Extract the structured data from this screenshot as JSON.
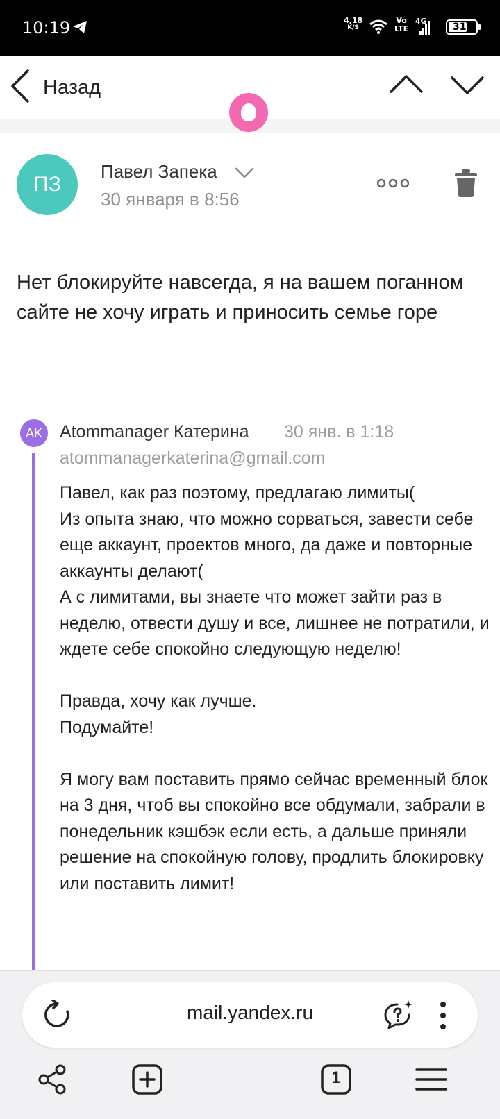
{
  "status_bar": {
    "time": "10:19",
    "speed_value": "4,18",
    "speed_unit": "K/S",
    "volte_top": "Vo",
    "volte_bottom": "LTE",
    "network": "4G",
    "battery": "31"
  },
  "header": {
    "back_label": "Назад"
  },
  "message": {
    "avatar_initials": "ПЗ",
    "avatar_color": "#4cc9bc",
    "sender_name": "Павел Запека",
    "date": "30 января в 8:56",
    "body": "Нет блокируйте навсегда, я на вашем поганном сайте не хочу играть и приносить семье горе"
  },
  "quoted": {
    "avatar_initials": "AK",
    "avatar_color": "#9a6ee4",
    "sender_name": "Atommanager Катерина",
    "date": "30 янв. в 1:18",
    "email": "atommanagerkaterina@gmail.com",
    "paragraphs": [
      "Павел, как раз поэтому, предлагаю лимиты(\nИз опыта знаю, что можно сорваться, завести себе еще аккаунт, проектов много, да даже и повторные аккаунты делают(\nА с лимитами, вы знаете что может зайти раз в неделю, отвести душу и все, лишнее не потратили, и ждете себе спокойно следующую неделю!",
      "Правда, хочу как лучше.\nПодумайте!",
      "Я могу вам поставить прямо сейчас временный блок на 3 дня, чтоб вы спокойно все обдумали, забрали в понедельник кэшбэк если есть, а дальше приняли решение на спокойную голову, продлить блокировку или поставить лимит!"
    ]
  },
  "browser": {
    "url": "mail.yandex.ru",
    "tab_count": "1",
    "alice_color": "#f36ab3"
  }
}
